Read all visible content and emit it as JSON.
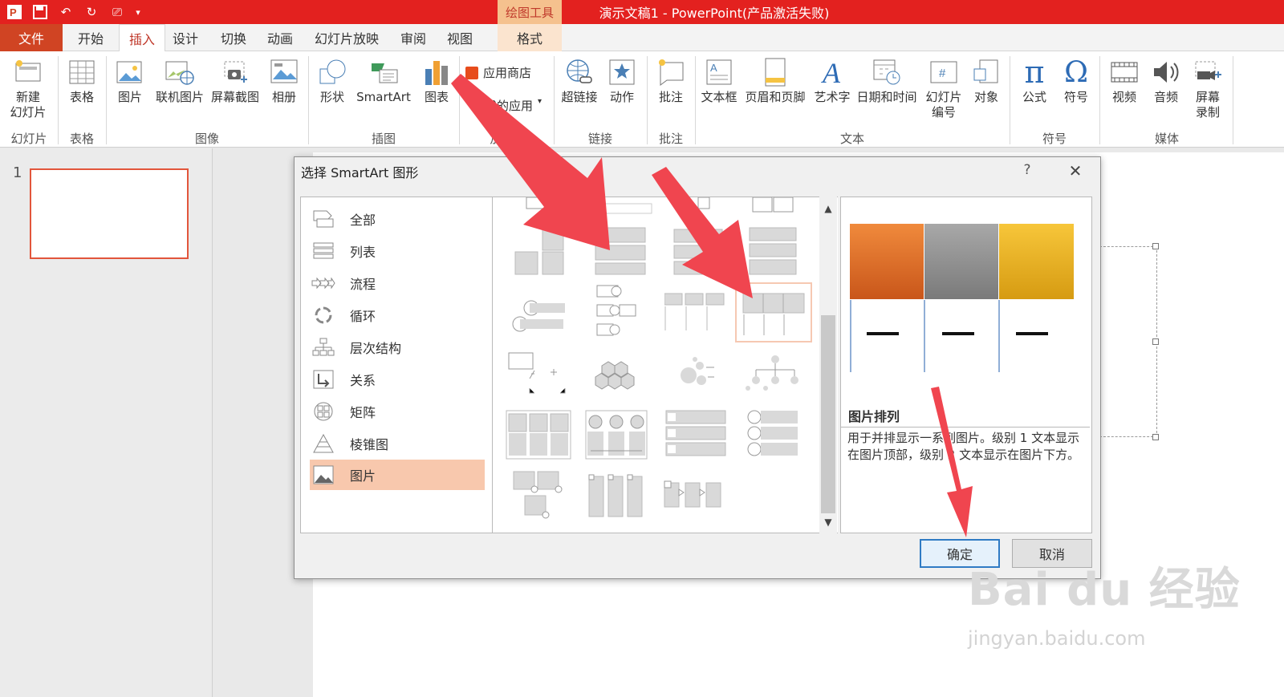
{
  "window": {
    "title": "演示文稿1 - PowerPoint(产品激活失败)",
    "context_tab_group": "绘图工具"
  },
  "tabs": [
    "文件",
    "开始",
    "插入",
    "设计",
    "切换",
    "动画",
    "幻灯片放映",
    "审阅",
    "视图",
    "格式"
  ],
  "ribbon": {
    "buttons": {
      "new_slide": "新建\n幻灯片",
      "table": "表格",
      "picture": "图片",
      "online_picture": "联机图片",
      "screenshot": "屏幕截图",
      "album": "相册",
      "shapes": "形状",
      "smartart": "SmartArt",
      "chart": "图表",
      "app_store": "应用商店",
      "my_apps": "我的应用",
      "hyperlink": "超链接",
      "action": "动作",
      "comment": "批注",
      "textbox": "文本框",
      "header_footer": "页眉和页脚",
      "wordart": "艺术字",
      "datetime": "日期和时间",
      "slide_number": "幻灯片\n编号",
      "object": "对象",
      "equation": "公式",
      "symbol": "符号",
      "video": "视频",
      "audio": "音频",
      "screen_recording": "屏幕\n录制"
    },
    "groups": {
      "slides": "幻灯片",
      "tables": "表格",
      "images": "图像",
      "illustrations": "插图",
      "addins": "加",
      "links": "链接",
      "comments": "批注",
      "text": "文本",
      "symbols": "符号",
      "media": "媒体"
    }
  },
  "thumbnail": {
    "number": "1"
  },
  "dialog": {
    "title": "选择 SmartArt 图形",
    "help": "?",
    "close": "✕",
    "categories": [
      "全部",
      "列表",
      "流程",
      "循环",
      "层次结构",
      "关系",
      "矩阵",
      "棱锥图",
      "图片"
    ],
    "selected_category": "图片",
    "preview_name": "图片排列",
    "preview_description": "用于并排显示一系列图片。级别 1 文本显示在图片顶部，级别 2 文本显示在图片下方。",
    "ok": "确定",
    "cancel": "取消"
  },
  "watermark": {
    "brand": "Bai du 经验",
    "url": "jingyan.baidu.com"
  },
  "colors": {
    "title_bar": "#e3211f",
    "file_tab": "#d04423",
    "selection": "#f8c8ad",
    "preview_orange": "#d8641d",
    "preview_gray": "#8a8a8a",
    "preview_gold": "#e5a91b",
    "annotation_arrow": "#f0454f"
  }
}
